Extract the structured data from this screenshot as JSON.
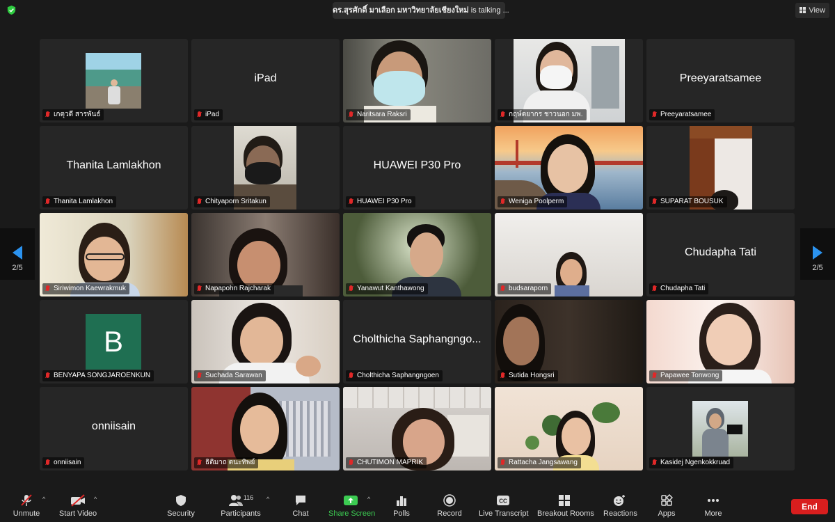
{
  "header": {
    "talking_name": "ดร.สุรศักดิ์ มาเลือก มหาวิทยาลัยเชียงใหม่",
    "talking_suffix": " is talking ...",
    "view_label": "View"
  },
  "pager": {
    "left_label": "2/5",
    "right_label": "2/5"
  },
  "tiles": [
    {
      "name": "เกตุวดี สารพันธ์",
      "big": "",
      "kind": "photo"
    },
    {
      "name": "iPad",
      "big": "iPad",
      "kind": "text"
    },
    {
      "name": "Naritsara Raksri",
      "big": "",
      "kind": "video"
    },
    {
      "name": "กฤษ์ตยากร ชาวนอก มพ.",
      "big": "",
      "kind": "video"
    },
    {
      "name": "Preeyaratsamee",
      "big": "Preeyaratsamee",
      "kind": "text"
    },
    {
      "name": "Thanita Lamlakhon",
      "big": "Thanita Lamlakhon",
      "kind": "text"
    },
    {
      "name": "Chityaporn Sritakun",
      "big": "",
      "kind": "video"
    },
    {
      "name": "HUAWEI P30 Pro",
      "big": "HUAWEI P30 Pro",
      "kind": "text"
    },
    {
      "name": "Weniga Poolperm",
      "big": "",
      "kind": "video"
    },
    {
      "name": "SUPARAT BOUSUK",
      "big": "",
      "kind": "video"
    },
    {
      "name": "Siriwimon Kaewrakmuk",
      "big": "",
      "kind": "video"
    },
    {
      "name": "Napapohn Rajcharak",
      "big": "",
      "kind": "video"
    },
    {
      "name": "Yanawut Kanthawong",
      "big": "",
      "kind": "video"
    },
    {
      "name": "budsaraporn",
      "big": "",
      "kind": "video"
    },
    {
      "name": "Chudapha Tati",
      "big": "Chudapha Tati",
      "kind": "text"
    },
    {
      "name": "BENYAPA SONGJAROENKUN",
      "big": "B",
      "kind": "avatar"
    },
    {
      "name": "Suchada Sarawan",
      "big": "",
      "kind": "video"
    },
    {
      "name": "Cholthicha Saphangngoen",
      "big": "Cholthicha Saphangngo...",
      "kind": "text"
    },
    {
      "name": "Sutida Hongsri",
      "big": "",
      "kind": "video"
    },
    {
      "name": "Papawee Tonwong",
      "big": "",
      "kind": "video"
    },
    {
      "name": "onniisain",
      "big": "onniisain",
      "kind": "text"
    },
    {
      "name": "ธิติมาถ ตนะทิพย์",
      "big": "",
      "kind": "video"
    },
    {
      "name": "CHUTIMON MAPRIK",
      "big": "",
      "kind": "video"
    },
    {
      "name": "Rattacha Jangsawang",
      "big": "",
      "kind": "video"
    },
    {
      "name": "Kasidej Ngenkokkruad",
      "big": "",
      "kind": "photo"
    }
  ],
  "toolbar": {
    "unmute": "Unmute",
    "start_video": "Start Video",
    "security": "Security",
    "participants": "Participants",
    "participants_count": "116",
    "chat": "Chat",
    "share_screen": "Share Screen",
    "polls": "Polls",
    "record": "Record",
    "live_transcript": "Live Transcript",
    "breakout_rooms": "Breakout Rooms",
    "reactions": "Reactions",
    "apps": "Apps",
    "more": "More",
    "end": "End"
  },
  "colors": {
    "accent_blue": "#2b93f0",
    "share_green": "#3ccb52",
    "end_red": "#d81e1e",
    "muted_mic_red": "#e02828"
  }
}
